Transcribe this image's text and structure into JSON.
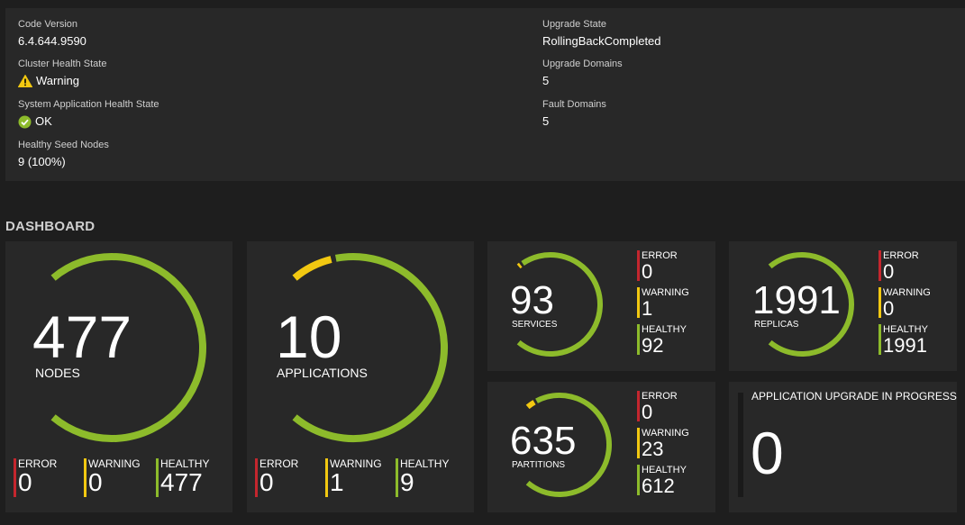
{
  "essentials": {
    "code_version": {
      "label": "Code Version",
      "value": "6.4.644.9590"
    },
    "cluster_health": {
      "label": "Cluster Health State",
      "value": "Warning"
    },
    "system_app_health": {
      "label": "System Application Health State",
      "value": "OK"
    },
    "healthy_seed_nodes": {
      "label": "Healthy Seed Nodes",
      "value": "9 (100%)"
    },
    "upgrade_state": {
      "label": "Upgrade State",
      "value": "RollingBackCompleted"
    },
    "upgrade_domains": {
      "label": "Upgrade Domains",
      "value": "5"
    },
    "fault_domains": {
      "label": "Fault Domains",
      "value": "5"
    }
  },
  "dashboard": {
    "title": "DASHBOARD",
    "colors": {
      "error": "#c4262e",
      "warning": "#f2c811",
      "healthy": "#8dbb2b"
    },
    "nodes": {
      "count": "477",
      "label": "NODES",
      "error": "0",
      "warning": "0",
      "healthy": "477",
      "warning_fraction": 0
    },
    "applications": {
      "count": "10",
      "label": "APPLICATIONS",
      "error": "0",
      "warning": "1",
      "healthy": "9",
      "warning_fraction": 0.1
    },
    "services": {
      "count": "93",
      "label": "SERVICES",
      "error": "0",
      "warning": "1",
      "healthy": "92",
      "warning_fraction": 0.0108
    },
    "replicas": {
      "count": "1991",
      "label": "REPLICAS",
      "error": "0",
      "warning": "0",
      "healthy": "1991",
      "warning_fraction": 0
    },
    "partitions": {
      "count": "635",
      "label": "PARTITIONS",
      "error": "0",
      "warning": "23",
      "healthy": "612",
      "warning_fraction": 0.0362
    },
    "stat_labels": {
      "error": "ERROR",
      "warning": "WARNING",
      "healthy": "HEALTHY"
    },
    "upgrade": {
      "title": "APPLICATION UPGRADE IN PROGRESS",
      "count": "0"
    }
  }
}
